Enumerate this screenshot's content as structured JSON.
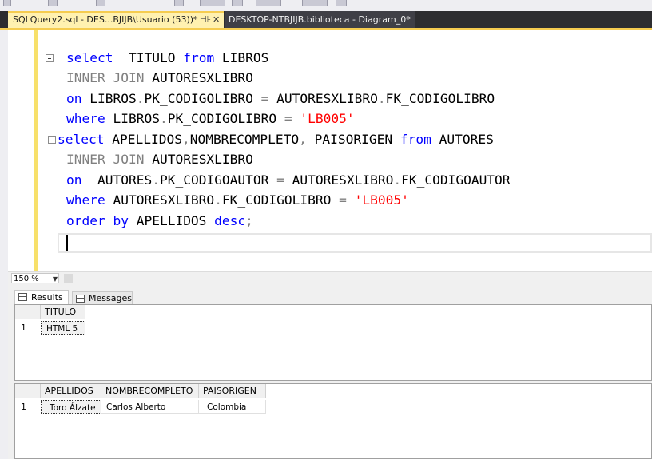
{
  "tabs": [
    {
      "label": "SQLQuery2.sql - DES...BJIJB\\Usuario (53))*",
      "pin": "⊣⊧",
      "close": "✕"
    },
    {
      "label": "DESKTOP-NTBJIJB.biblioteca - Diagram_0*"
    }
  ],
  "editor": {
    "lines": [
      {
        "tokens": [
          {
            "t": "select",
            "c": "kw"
          },
          {
            "t": "  TITULO ",
            "c": ""
          },
          {
            "t": "from",
            "c": "kw"
          },
          {
            "t": " LIBROS",
            "c": ""
          }
        ]
      },
      {
        "tokens": [
          {
            "t": "INNER JOIN",
            "c": "gray"
          },
          {
            "t": " AUTORESXLIBRO",
            "c": ""
          }
        ]
      },
      {
        "tokens": [
          {
            "t": "on",
            "c": "kw"
          },
          {
            "t": " LIBROS",
            "c": ""
          },
          {
            "t": ".",
            "c": "ob"
          },
          {
            "t": "PK_CODIGOLIBRO ",
            "c": ""
          },
          {
            "t": "=",
            "c": "ob"
          },
          {
            "t": " AUTORESXLIBRO",
            "c": ""
          },
          {
            "t": ".",
            "c": "ob"
          },
          {
            "t": "FK_CODIGOLIBRO",
            "c": ""
          }
        ]
      },
      {
        "tokens": [
          {
            "t": "where",
            "c": "kw"
          },
          {
            "t": " LIBROS",
            "c": ""
          },
          {
            "t": ".",
            "c": "ob"
          },
          {
            "t": "PK_CODIGOLIBRO ",
            "c": ""
          },
          {
            "t": "=",
            "c": "ob"
          },
          {
            "t": " ",
            "c": ""
          },
          {
            "t": "'LB005'",
            "c": "str"
          }
        ]
      },
      {
        "tokens": [
          {
            "t": "select",
            "c": "kw"
          },
          {
            "t": " APELLIDOS",
            "c": ""
          },
          {
            "t": ",",
            "c": "ob"
          },
          {
            "t": "NOMBRECOMPLETO",
            "c": ""
          },
          {
            "t": ",",
            "c": "ob"
          },
          {
            "t": " PAISORIGEN ",
            "c": ""
          },
          {
            "t": "from",
            "c": "kw"
          },
          {
            "t": " AUTORES",
            "c": ""
          }
        ]
      },
      {
        "tokens": [
          {
            "t": "INNER JOIN",
            "c": "gray"
          },
          {
            "t": " AUTORESXLIBRO",
            "c": ""
          }
        ]
      },
      {
        "tokens": [
          {
            "t": "on",
            "c": "kw"
          },
          {
            "t": "  AUTORES",
            "c": ""
          },
          {
            "t": ".",
            "c": "ob"
          },
          {
            "t": "PK_CODIGOAUTOR ",
            "c": ""
          },
          {
            "t": "=",
            "c": "ob"
          },
          {
            "t": " AUTORESXLIBRO",
            "c": ""
          },
          {
            "t": ".",
            "c": "ob"
          },
          {
            "t": "FK_CODIGOAUTOR",
            "c": ""
          }
        ]
      },
      {
        "tokens": [
          {
            "t": "where",
            "c": "kw"
          },
          {
            "t": " AUTORESXLIBRO",
            "c": ""
          },
          {
            "t": ".",
            "c": "ob"
          },
          {
            "t": "FK_CODIGOLIBRO ",
            "c": ""
          },
          {
            "t": "=",
            "c": "ob"
          },
          {
            "t": " ",
            "c": ""
          },
          {
            "t": "'LB005'",
            "c": "str"
          }
        ]
      },
      {
        "tokens": [
          {
            "t": "order by",
            "c": "kw"
          },
          {
            "t": " APELLIDOS ",
            "c": ""
          },
          {
            "t": "desc",
            "c": "kw"
          },
          {
            "t": ";",
            "c": "ob"
          }
        ]
      }
    ]
  },
  "zoom": {
    "value": "150 %"
  },
  "results": {
    "tabs": [
      {
        "label": "Results"
      },
      {
        "label": "Messages"
      }
    ],
    "grid1": {
      "columns": [
        "TITULO"
      ],
      "rows": [
        {
          "num": "1",
          "cells": [
            "HTML 5"
          ]
        }
      ]
    },
    "grid2": {
      "columns": [
        "APELLIDOS",
        "NOMBRECOMPLETO",
        "PAISORIGEN"
      ],
      "rows": [
        {
          "num": "1",
          "cells": [
            "Toro Álzate",
            "Carlos Alberto",
            "Colombia"
          ]
        }
      ]
    }
  }
}
